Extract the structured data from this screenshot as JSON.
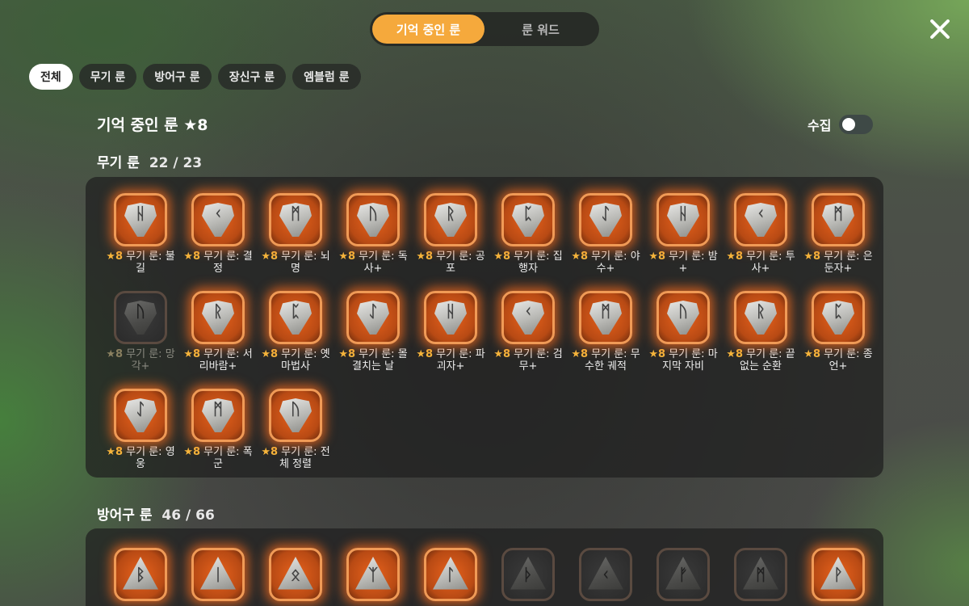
{
  "header": {
    "tabs": [
      {
        "label": "기억 중인 룬",
        "active": true
      },
      {
        "label": "룬 워드",
        "active": false
      }
    ],
    "close_icon": "close-icon"
  },
  "filters": [
    {
      "label": "전체",
      "active": true
    },
    {
      "label": "무기 룬",
      "active": false
    },
    {
      "label": "방어구 룬",
      "active": false
    },
    {
      "label": "장신구 룬",
      "active": false
    },
    {
      "label": "엠블럼 룬",
      "active": false
    }
  ],
  "section": {
    "title": "기억 중인 룬 ★8",
    "collect_label": "수집",
    "collect_on": false
  },
  "categories": [
    {
      "title": "무기 룬",
      "count": "22 / 23",
      "items": [
        {
          "star": "★8",
          "name": "무기 룬: 불길",
          "glyph": "ᚺ",
          "locked": false
        },
        {
          "star": "★8",
          "name": "무기 룬: 결정",
          "glyph": "ᚲ",
          "locked": false
        },
        {
          "star": "★8",
          "name": "무기 룬: 뇌명",
          "glyph": "ᛗ",
          "locked": false
        },
        {
          "star": "★8",
          "name": "무기 룬: 독사+",
          "glyph": "ᚢ",
          "locked": false
        },
        {
          "star": "★8",
          "name": "무기 룬: 공포",
          "glyph": "ᚱ",
          "locked": false
        },
        {
          "star": "★8",
          "name": "무기 룬: 집행자",
          "glyph": "ᛈ",
          "locked": false
        },
        {
          "star": "★8",
          "name": "무기 룬: 야수+",
          "glyph": "ᛇ",
          "locked": false
        },
        {
          "star": "★8",
          "name": "무기 룬: 밤+",
          "glyph": "ᚺ",
          "locked": false
        },
        {
          "star": "★8",
          "name": "무기 룬: 투사+",
          "glyph": "ᚲ",
          "locked": false
        },
        {
          "star": "★8",
          "name": "무기 룬: 은둔자+",
          "glyph": "ᛗ",
          "locked": false
        },
        {
          "star": "★8",
          "name": "무기 룬: 망각+",
          "glyph": "ᚢ",
          "locked": true
        },
        {
          "star": "★8",
          "name": "무기 룬: 서리바람+",
          "glyph": "ᚱ",
          "locked": false
        },
        {
          "star": "★8",
          "name": "무기 룬: 옛 마법사",
          "glyph": "ᛈ",
          "locked": false
        },
        {
          "star": "★8",
          "name": "무기 룬: 몰결치는 날",
          "glyph": "ᛇ",
          "locked": false
        },
        {
          "star": "★8",
          "name": "무기 룬: 파괴자+",
          "glyph": "ᚺ",
          "locked": false
        },
        {
          "star": "★8",
          "name": "무기 룬: 검무+",
          "glyph": "ᚲ",
          "locked": false
        },
        {
          "star": "★8",
          "name": "무기 룬: 무수한 궤적",
          "glyph": "ᛗ",
          "locked": false
        },
        {
          "star": "★8",
          "name": "무기 룬: 마지막 자비",
          "glyph": "ᚢ",
          "locked": false
        },
        {
          "star": "★8",
          "name": "무기 룬: 끝없는 순환",
          "glyph": "ᚱ",
          "locked": false
        },
        {
          "star": "★8",
          "name": "무기 룬: 종언+",
          "glyph": "ᛈ",
          "locked": false
        },
        {
          "star": "★8",
          "name": "무기 룬: 영웅",
          "glyph": "ᛇ",
          "locked": false
        },
        {
          "star": "★8",
          "name": "무기 룬: 폭군",
          "glyph": "ᛗ",
          "locked": false
        },
        {
          "star": "★8",
          "name": "무기 룬: 전체 정렬",
          "glyph": "ᚢ",
          "locked": false
        }
      ]
    },
    {
      "title": "방어구 룬",
      "count": "46 / 66",
      "items": [
        {
          "glyph": "ᛒ",
          "locked": false
        },
        {
          "glyph": "ᛁ",
          "locked": false
        },
        {
          "glyph": "ᛟ",
          "locked": false
        },
        {
          "glyph": "ᛉ",
          "locked": false
        },
        {
          "glyph": "ᛚ",
          "locked": false
        },
        {
          "glyph": "ᚦ",
          "locked": true
        },
        {
          "glyph": "ᚲ",
          "locked": true
        },
        {
          "glyph": "ᚠ",
          "locked": true
        },
        {
          "glyph": "ᛗ",
          "locked": true
        },
        {
          "glyph": "ᚹ",
          "locked": false
        }
      ]
    }
  ],
  "colors": {
    "accent": "#f5a93c",
    "rune_glow": "#ff6e1e",
    "star": "#f5b53c"
  }
}
